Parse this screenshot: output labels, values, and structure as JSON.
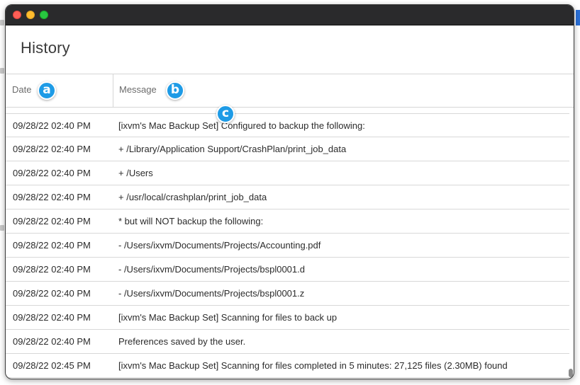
{
  "window": {
    "title": "History"
  },
  "columns": {
    "date": "Date",
    "message": "Message"
  },
  "callouts": {
    "a": "a",
    "b": "b",
    "c": "c"
  },
  "rows": [
    {
      "date": "09/28/22 02:40 PM",
      "message": "[ixvm's Mac Backup Set] Configured to backup the following:"
    },
    {
      "date": "09/28/22 02:40 PM",
      "message": "+ /Library/Application Support/CrashPlan/print_job_data"
    },
    {
      "date": "09/28/22 02:40 PM",
      "message": "+ /Users"
    },
    {
      "date": "09/28/22 02:40 PM",
      "message": "+ /usr/local/crashplan/print_job_data"
    },
    {
      "date": "09/28/22 02:40 PM",
      "message": "* but will NOT backup the following:"
    },
    {
      "date": "09/28/22 02:40 PM",
      "message": "- /Users/ixvm/Documents/Projects/Accounting.pdf"
    },
    {
      "date": "09/28/22 02:40 PM",
      "message": "- /Users/ixvm/Documents/Projects/bspl0001.d"
    },
    {
      "date": "09/28/22 02:40 PM",
      "message": "- /Users/ixvm/Documents/Projects/bspl0001.z"
    },
    {
      "date": "09/28/22 02:40 PM",
      "message": "[ixvm's Mac Backup Set] Scanning for files to back up"
    },
    {
      "date": "09/28/22 02:40 PM",
      "message": "Preferences saved by the user."
    },
    {
      "date": "09/28/22 02:45 PM",
      "message": "[ixvm's Mac Backup Set] Scanning for files completed in 5 minutes: 27,125 files (2.30MB) found"
    }
  ],
  "colors": {
    "accent": "#1e9be6",
    "titlebar": "#2a2a2c",
    "close": "#fe5f57",
    "minimize": "#febc2e",
    "maximize": "#28c840"
  }
}
